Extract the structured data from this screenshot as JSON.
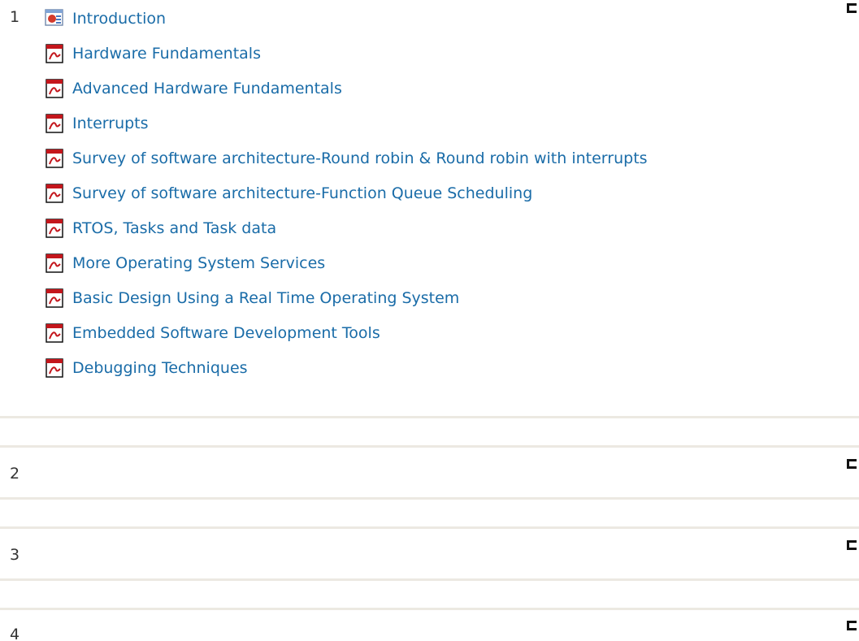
{
  "sections": [
    {
      "number": "1",
      "items": [
        {
          "label": "Introduction",
          "icon": "powerpoint-icon"
        },
        {
          "label": "Hardware Fundamentals",
          "icon": "pdf-icon"
        },
        {
          "label": "Advanced Hardware Fundamentals",
          "icon": "pdf-icon"
        },
        {
          "label": "Interrupts",
          "icon": "pdf-icon"
        },
        {
          "label": "Survey of software architecture-Round robin & Round robin with interrupts",
          "icon": "pdf-icon"
        },
        {
          "label": "Survey of software architecture-Function Queue Scheduling",
          "icon": "pdf-icon"
        },
        {
          "label": "RTOS, Tasks and Task data",
          "icon": "pdf-icon"
        },
        {
          "label": "More Operating System Services",
          "icon": "pdf-icon"
        },
        {
          "label": "Basic Design Using a Real Time Operating System",
          "icon": "pdf-icon"
        },
        {
          "label": "Embedded Software Development Tools",
          "icon": "pdf-icon"
        },
        {
          "label": "Debugging Techniques",
          "icon": "pdf-icon"
        }
      ]
    },
    {
      "number": "2",
      "items": []
    },
    {
      "number": "3",
      "items": []
    },
    {
      "number": "4",
      "items": []
    }
  ],
  "colors": {
    "link": "#1a6ca8",
    "divider": "#ece9e2",
    "pdf_red": "#c4161c",
    "ppt_red": "#d33a2c"
  }
}
